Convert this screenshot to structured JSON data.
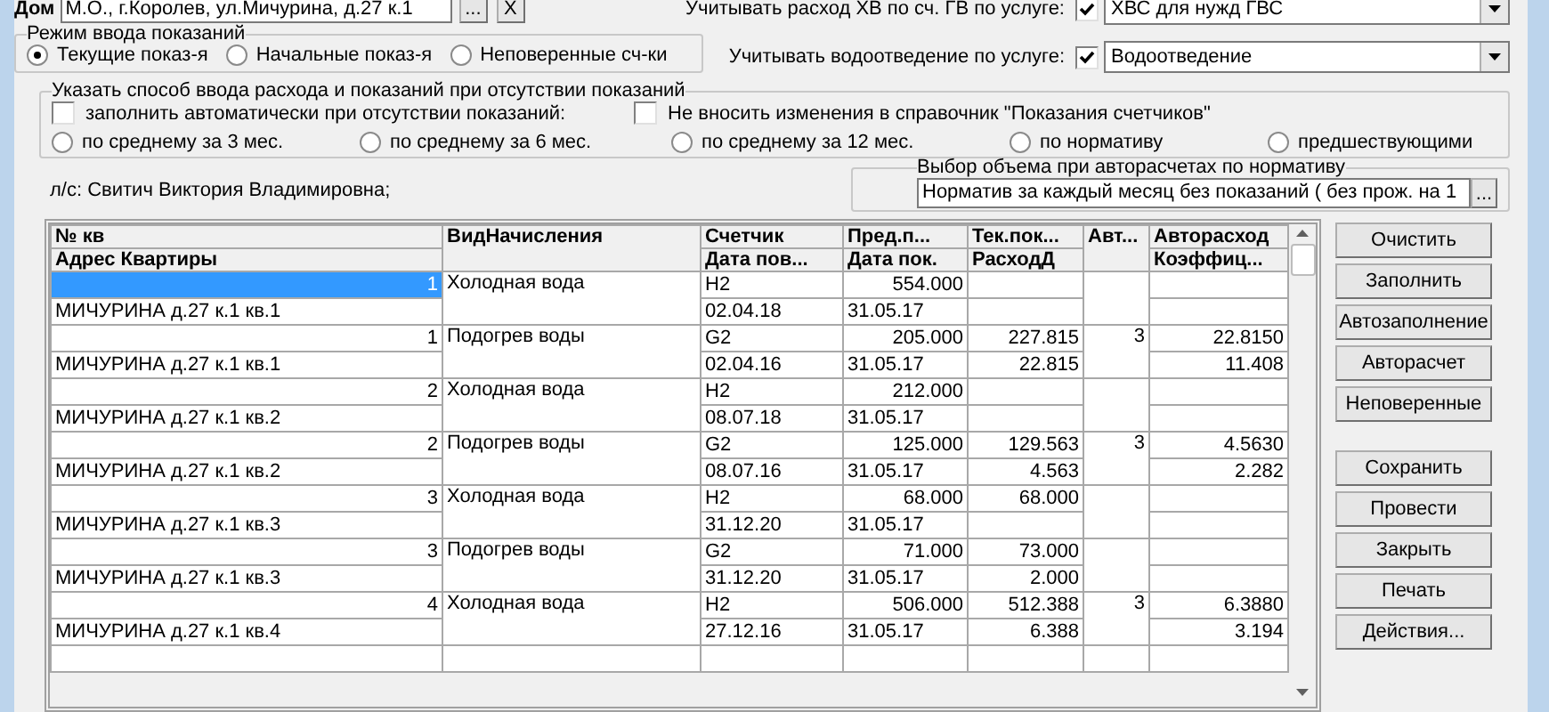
{
  "house": {
    "label": "Дом",
    "value": "М.О., г.Королев, ул.Мичурина, д.27 к.1",
    "browse": "...",
    "clear": "X"
  },
  "services": [
    {
      "label": "Учитывать расход ХВ по сч. ГВ по услуге:",
      "checked": true,
      "value": "ХВС для нужд ГВС"
    },
    {
      "label": "Учитывать водоотведение по услуге:",
      "checked": true,
      "value": "Водоотведение"
    }
  ],
  "mode": {
    "title": "Режим ввода  показаний",
    "options": [
      {
        "label": "Текущие показ-я",
        "selected": true
      },
      {
        "label": "Начальные показ-я",
        "selected": false
      },
      {
        "label": "Неповеренные сч-ки",
        "selected": false
      }
    ]
  },
  "missing": {
    "title": "Указать способ ввода расхода и показаний при отсутствии показаний",
    "checks": [
      {
        "label": "заполнить  автоматически при отсутствии показаний:",
        "checked": false
      },
      {
        "label": "Не вносить изменения в справочник \"Показания счетчиков\"",
        "checked": false
      }
    ],
    "options": [
      {
        "label": "по среднему за 3 мес.",
        "selected": false
      },
      {
        "label": "по среднему за 6 мес.",
        "selected": false
      },
      {
        "label": "по среднему за 12 мес.",
        "selected": false
      },
      {
        "label": "по нормативу",
        "selected": false
      },
      {
        "label": "предшествующими",
        "selected": false
      }
    ]
  },
  "account": "л/с: Свитич Виктория Владимировна;",
  "volume": {
    "title": "Выбор объема при авторасчетах по нормативу",
    "value": "Норматив за каждый месяц без показаний ( без прож. на 1",
    "browse": "..."
  },
  "table": {
    "columns": [
      {
        "top": "№ кв",
        "bottom": "Адрес Квартиры"
      },
      {
        "top": "ВидНачисления"
      },
      {
        "top": "Счетчик",
        "bottom": "Дата пов..."
      },
      {
        "top": "Пред.п...",
        "bottom": "Дата пок."
      },
      {
        "top": "Тек.пок...",
        "bottom": "РасходД"
      },
      {
        "top": "Авт..."
      },
      {
        "top": "Авторасход",
        "bottom": "Коэффиц..."
      }
    ],
    "rows": [
      {
        "selected": true,
        "apt": "1",
        "address": "МИЧУРИНА д.27 к.1 кв.1",
        "service": "Холодная вода",
        "meter": "H2",
        "verify_date": "02.04.18",
        "prev": "554.000",
        "prev_date": "31.05.17"
      },
      {
        "selected": false,
        "apt": "1",
        "address": "МИЧУРИНА д.27 к.1 кв.1",
        "service": "Подогрев воды",
        "meter": "G2",
        "verify_date": "02.04.16",
        "prev": "205.000",
        "prev_date": "31.05.17",
        "current": "227.815",
        "consumption": "22.815",
        "auto": "3",
        "auto_consumption": "22.8150",
        "coefficient": "11.408"
      },
      {
        "selected": false,
        "apt": "2",
        "address": "МИЧУРИНА д.27 к.1 кв.2",
        "service": "Холодная вода",
        "meter": "H2",
        "verify_date": "08.07.18",
        "prev": "212.000",
        "prev_date": "31.05.17"
      },
      {
        "selected": false,
        "apt": "2",
        "address": "МИЧУРИНА д.27 к.1 кв.2",
        "service": "Подогрев воды",
        "meter": "G2",
        "verify_date": "08.07.16",
        "prev": "125.000",
        "prev_date": "31.05.17",
        "current": "129.563",
        "consumption": "4.563",
        "auto": "3",
        "auto_consumption": "4.5630",
        "coefficient": "2.282"
      },
      {
        "selected": false,
        "apt": "3",
        "address": "МИЧУРИНА д.27 к.1 кв.3",
        "service": "Холодная вода",
        "meter": "H2",
        "verify_date": "31.12.20",
        "prev": "68.000",
        "prev_date": "31.05.17",
        "current": "68.000"
      },
      {
        "selected": false,
        "apt": "3",
        "address": "МИЧУРИНА д.27 к.1 кв.3",
        "service": "Подогрев воды",
        "meter": "G2",
        "verify_date": "31.12.20",
        "prev": "71.000",
        "prev_date": "31.05.17",
        "current": "73.000",
        "consumption": "2.000"
      },
      {
        "selected": false,
        "apt": "4",
        "address": "МИЧУРИНА д.27 к.1 кв.4",
        "service": "Холодная вода",
        "meter": "H2",
        "verify_date": "27.12.16",
        "prev": "506.000",
        "prev_date": "31.05.17",
        "current": "512.388",
        "consumption": "6.388",
        "auto": "3",
        "auto_consumption": "6.3880",
        "coefficient": "3.194"
      }
    ]
  },
  "buttons": [
    [
      "Очистить",
      "Заполнить",
      "Автозаполнение",
      "Авторасчет",
      "Неповеренные"
    ],
    [
      "Сохранить",
      "Провести",
      "Закрыть",
      "Печать",
      "Действия..."
    ]
  ]
}
